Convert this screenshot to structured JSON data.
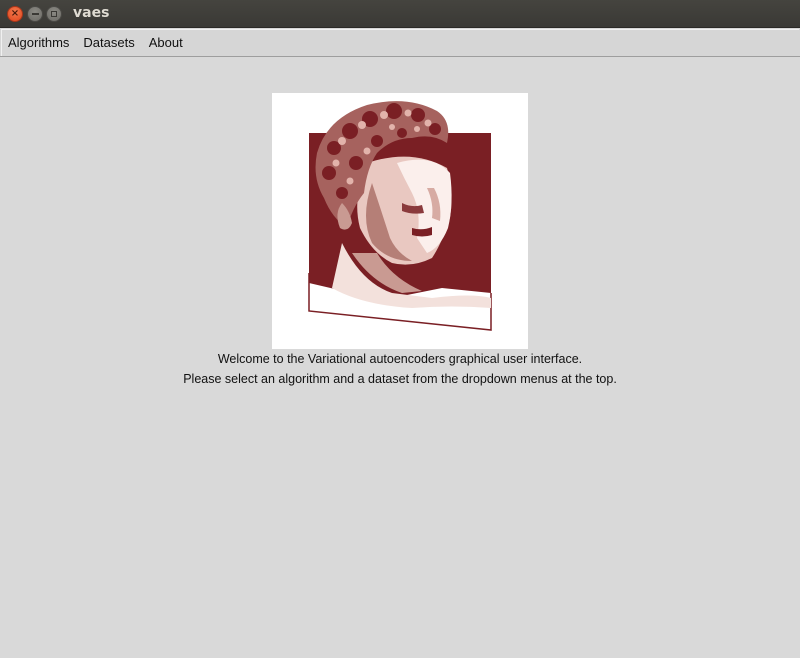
{
  "window": {
    "title": "vaes"
  },
  "menubar": {
    "items": [
      {
        "label": "Algorithms"
      },
      {
        "label": "Datasets"
      },
      {
        "label": "About"
      }
    ]
  },
  "main": {
    "logo": "hermes-bust-logo",
    "welcome_line": "Welcome to the Variational autoencoders graphical user interface.",
    "instruction_line": "Please select an algorithm and a dataset from the dropdown menus at the top."
  },
  "colors": {
    "accent": "#7a1f24",
    "background": "#d9d9d9",
    "titlebar": "#3c3b37"
  }
}
